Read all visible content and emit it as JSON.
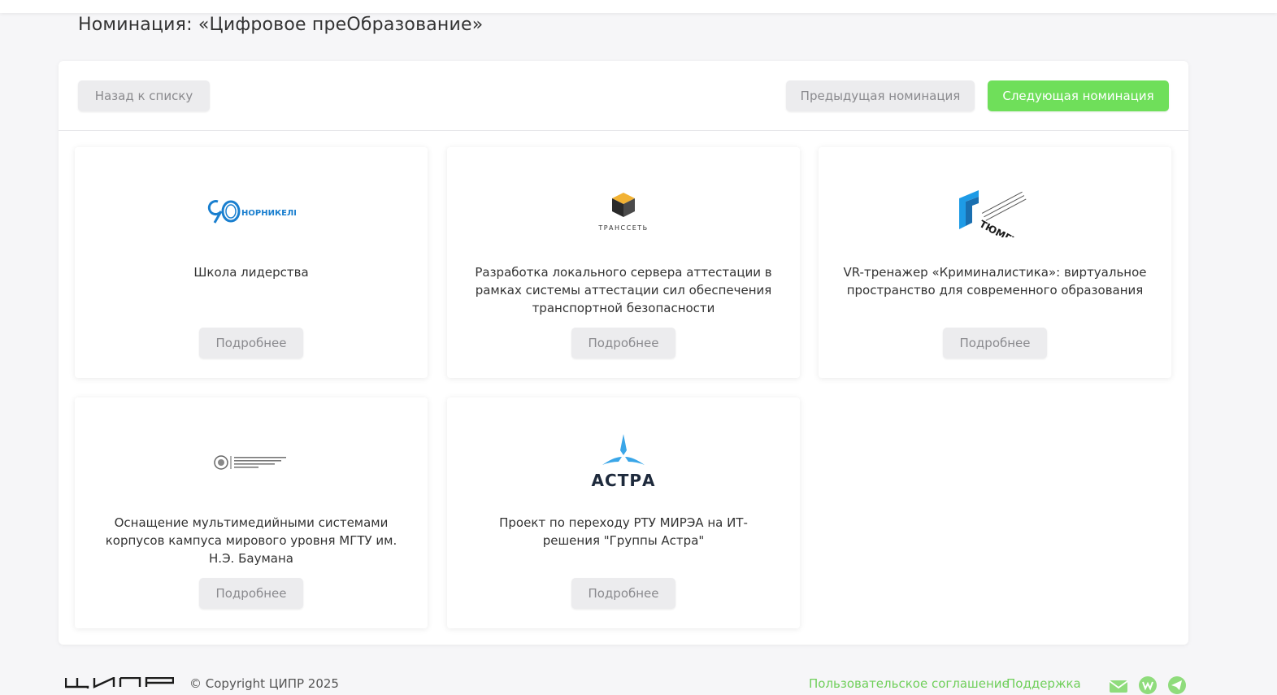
{
  "page": {
    "title": "Номинация: «Цифровое преОбразование»"
  },
  "toolbar": {
    "back_label": "Назад к списку",
    "prev_label": "Предыдущая номинация",
    "next_label": "Следующая номинация"
  },
  "cards": [
    {
      "title": "Школа лидерства",
      "logo_icon": "nornickel-90-logo",
      "logo_text": "НОРНИКЕЛЬ",
      "more_label": "Подробнее"
    },
    {
      "title": "Разработка локального сервера аттестации в рамках системы аттестации сил обеспечения транспортной безопасности",
      "logo_icon": "transset-logo",
      "logo_text": "ТРАНССЕТЬ",
      "more_label": "Подробнее"
    },
    {
      "title": "VR-тренажер «Криминалистика»: виртуальное пространство для современного образования",
      "logo_icon": "tyumgu-logo",
      "logo_text": "ТЮМГУ",
      "more_label": "Подробнее"
    },
    {
      "title": "Оснащение мультимедийными системами корпусов кампуса мирового уровня МГТУ им. Н.Э. Баумана",
      "logo_icon": "bauman-logo",
      "logo_text": "",
      "more_label": "Подробнее"
    },
    {
      "title": "Проект по переходу РТУ МИРЭА на ИТ-решения \"Группы Астра\"",
      "logo_icon": "astra-logo",
      "logo_text": "АСТРА",
      "more_label": "Подробнее"
    }
  ],
  "footer": {
    "logo_icon": "cipr-logo",
    "copyright": "© Copyright ЦИПР 2025",
    "agreement_label": "Пользовательское соглашение",
    "support_label": "Поддержка",
    "social_icons": [
      "mail-icon",
      "vk-icon",
      "telegram-icon"
    ]
  },
  "colors": {
    "accent": "#6fdf5a",
    "link": "#6fcf5a",
    "button_gray": "#ececee",
    "nornickel_blue": "#1a7fcf",
    "tyumgu_blue": "#1e9be6",
    "astra_blue": "#3aa6e8",
    "astra_dark": "#1e2a3c"
  }
}
